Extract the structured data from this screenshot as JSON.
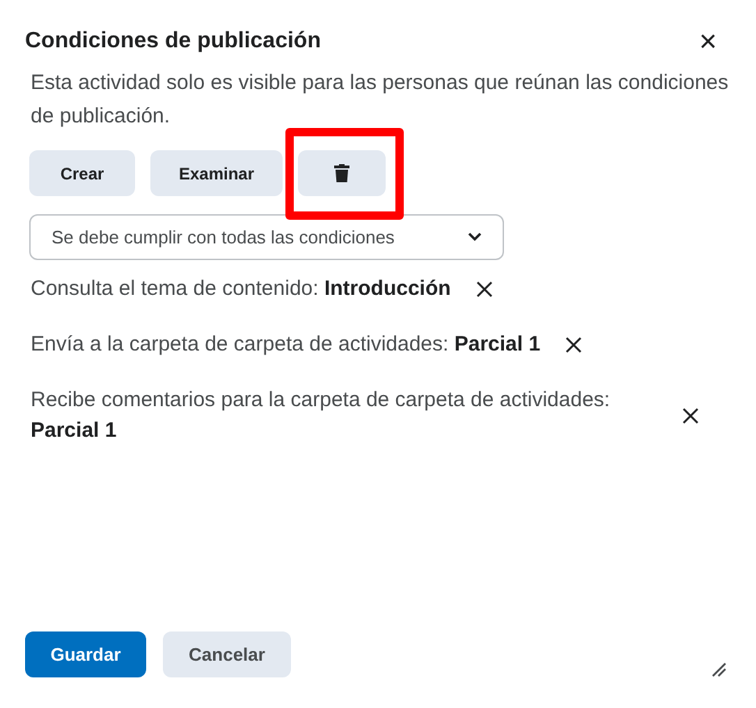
{
  "dialog": {
    "title": "Condiciones de publicación",
    "close": "×"
  },
  "description": "Esta actividad solo es visible para las personas que reúnan las condiciones de publicación.",
  "toolbar": [
    {
      "kind": "text",
      "label": "Crear",
      "highlighted": false
    },
    {
      "kind": "text",
      "label": "Examinar",
      "highlighted": false
    },
    {
      "kind": "delete",
      "highlighted": true
    }
  ],
  "match_select": {
    "value": "Se debe cumplir con todas las condiciones"
  },
  "conditions": [
    {
      "text": "Consulta el tema de contenido: **Introducción**"
    },
    {
      "text": "Envía a la carpeta de carpeta de actividades: **Parcial 1**"
    },
    {
      "text": "Recibe comentarios para la carpeta de carpeta de actividades: **Parcial 1**"
    }
  ],
  "footer": [
    {
      "kind": "primary",
      "label": "Guardar"
    },
    {
      "kind": "secondary",
      "label": "Cancelar"
    }
  ]
}
